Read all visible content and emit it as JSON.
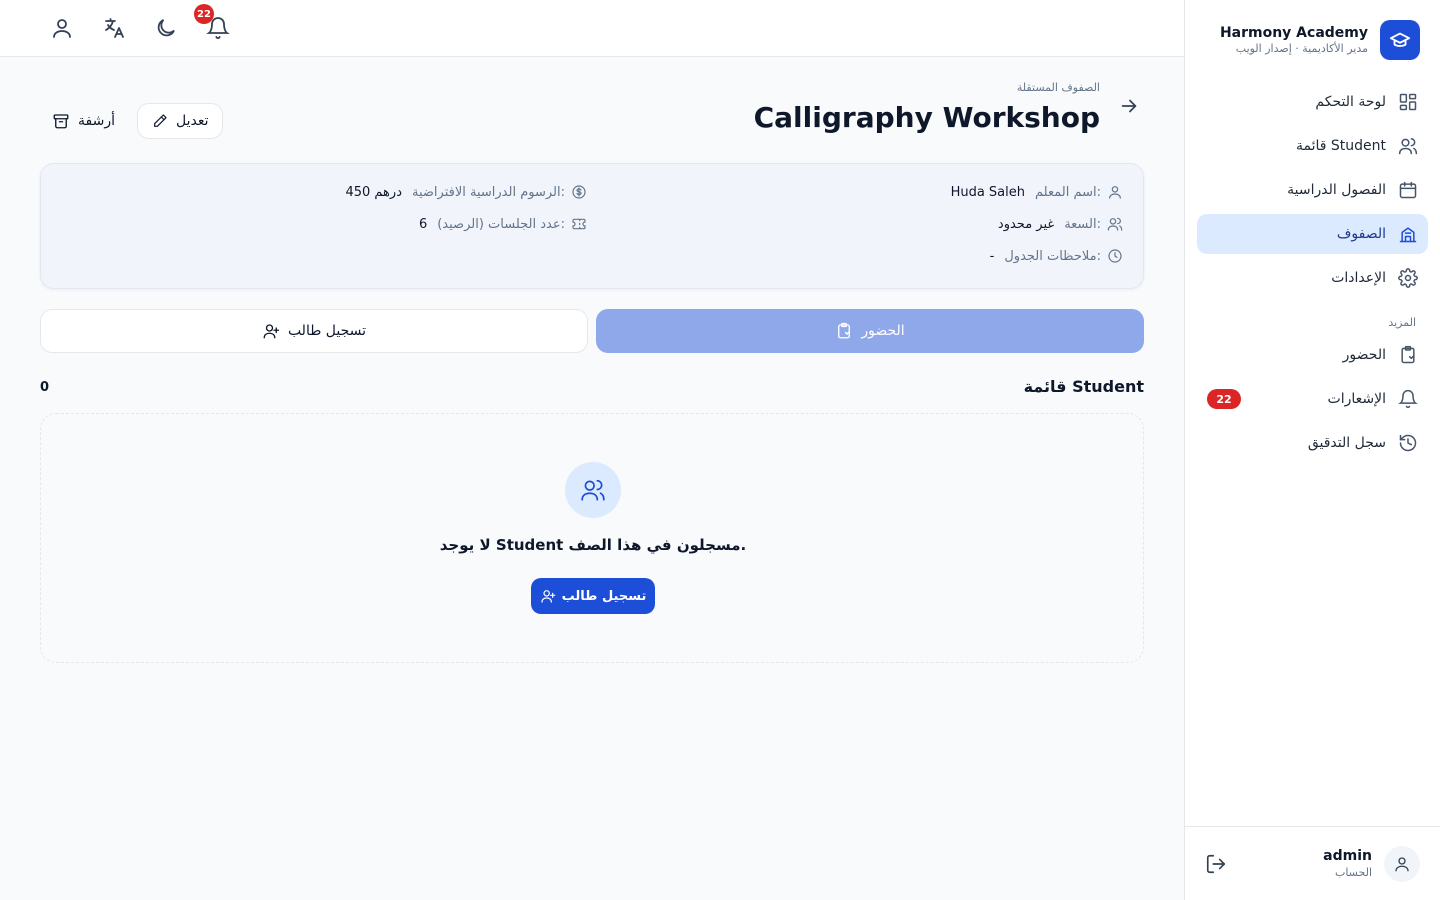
{
  "brand": {
    "title": "Harmony Academy",
    "subtitle": "مدير الأكاديمية · إصدار الويب",
    "logo_icon": "graduation-cap-icon"
  },
  "sidebar": {
    "items": [
      {
        "label": "لوحة التحكم",
        "icon": "dashboard-icon"
      },
      {
        "label": "قائمة Student",
        "icon": "users-icon"
      },
      {
        "label": "الفصول الدراسية",
        "icon": "calendar-icon"
      },
      {
        "label": "الصفوف",
        "icon": "school-icon",
        "active": true
      },
      {
        "label": "الإعدادات",
        "icon": "gear-icon"
      }
    ],
    "section_more": "المزيد",
    "more_items": [
      {
        "label": "الحضور",
        "icon": "clipboard-icon"
      },
      {
        "label": "الإشعارات",
        "icon": "bell-icon",
        "badge": "22"
      },
      {
        "label": "سجل التدقيق",
        "icon": "history-icon"
      }
    ]
  },
  "account": {
    "name": "admin",
    "role": "الحساب"
  },
  "topbar": {
    "notifications_badge": "22"
  },
  "page": {
    "breadcrumb": "الصفوف المستقلة",
    "title": "Calligraphy Workshop",
    "edit_label": "تعديل",
    "archive_label": "أرشفة"
  },
  "info": {
    "teacher_label": "اسم المعلم:",
    "teacher_value": "Huda Saleh",
    "capacity_label": "السعة:",
    "capacity_value": "غير محدود",
    "schedule_label": "ملاحظات الجدول:",
    "schedule_value": "-",
    "fee_label": "الرسوم الدراسية الافتراضية:",
    "fee_value": "450 درهم",
    "sessions_label": "عدد الجلسات (الرصيد):",
    "sessions_value": "6"
  },
  "actions": {
    "attendance": "الحضور",
    "register": "تسجيل طالب"
  },
  "list": {
    "title": "قائمة Student",
    "count": "0",
    "empty_text": "لا يوجد Student مسجلون في هذا الصف.",
    "empty_button": "تسجيل طالب"
  },
  "colors": {
    "primary": "#1d4ed8",
    "primary_light": "#dbeafe",
    "attendance_btn": "#8ea8ea",
    "badge": "#dc2626"
  }
}
